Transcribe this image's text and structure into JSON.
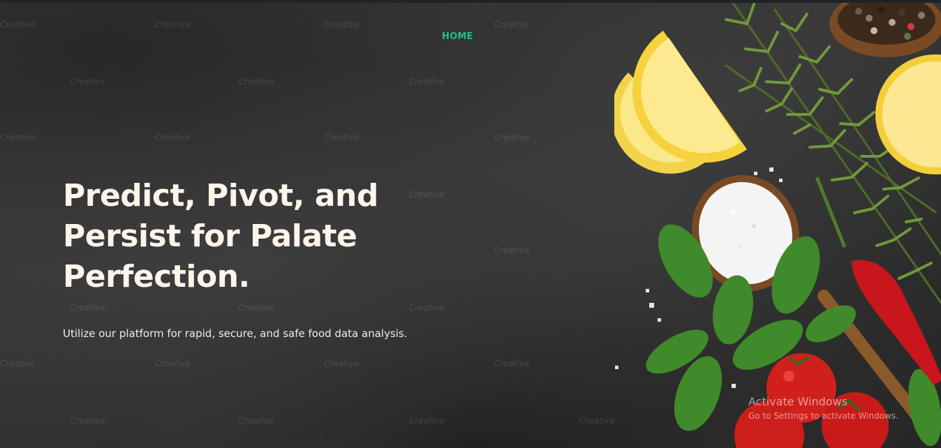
{
  "nav": {
    "home_label": "HOME"
  },
  "hero": {
    "headline": "Predict, Pivot, and Persist for Palate Perfection.",
    "subtitle": "Utilize our platform for rapid, secure, and safe food data analysis."
  },
  "watermark_text": "Creative",
  "system_overlay": {
    "title": "Activate Windows",
    "subtitle": "Go to Settings to activate Windows."
  },
  "colors": {
    "accent": "#21c087",
    "headline": "#fff4ea",
    "background": "#2f2f2f"
  }
}
